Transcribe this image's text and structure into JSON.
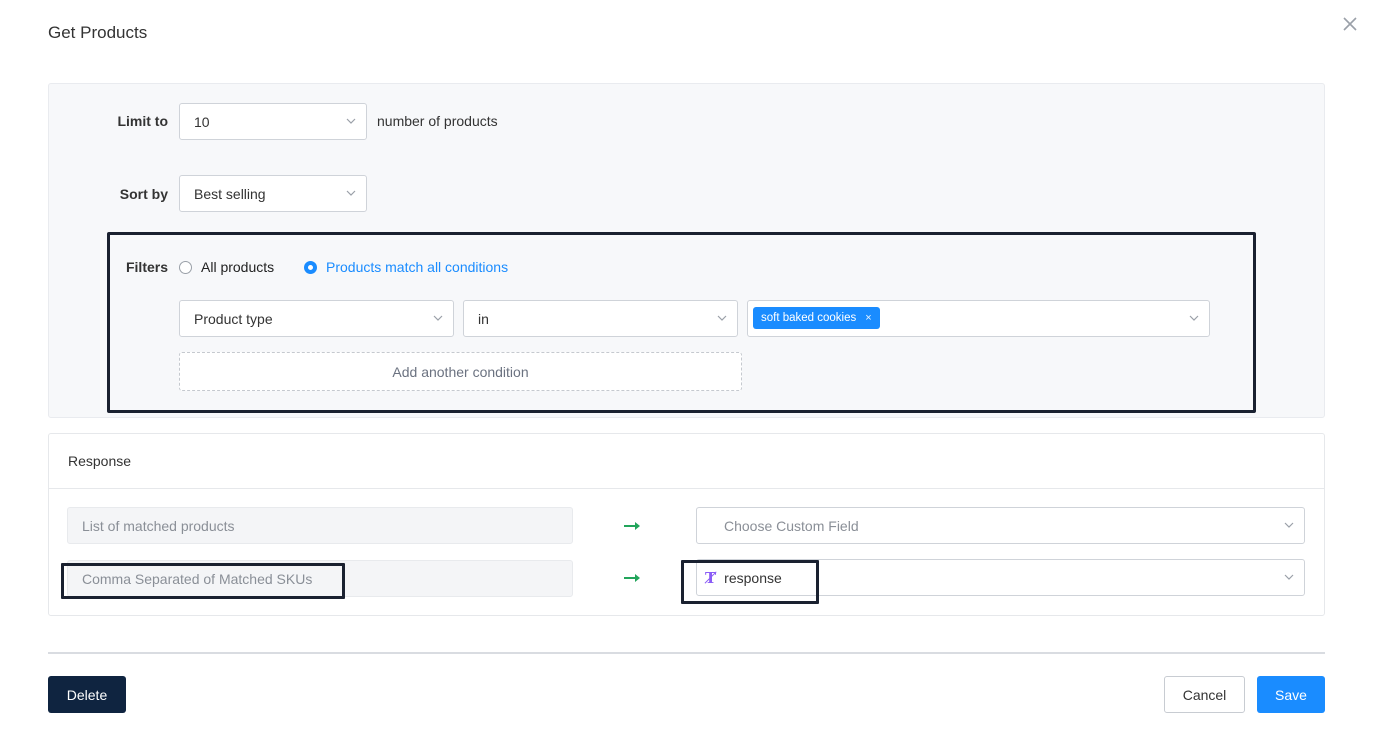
{
  "dialog": {
    "title": "Get Products"
  },
  "limit": {
    "label": "Limit to",
    "value": "10",
    "suffix": "number of products"
  },
  "sort": {
    "label": "Sort by",
    "value": "Best selling"
  },
  "filters": {
    "label": "Filters",
    "options": [
      {
        "label": "All products",
        "selected": false
      },
      {
        "label": "Products match all conditions",
        "selected": true
      }
    ],
    "condition": {
      "field": "Product type",
      "operator": "in",
      "values": [
        "soft baked cookies"
      ]
    },
    "add_condition_label": "Add another condition"
  },
  "response": {
    "header": "Response",
    "mappings": [
      {
        "source": "List of matched products",
        "target": "Choose Custom Field",
        "target_is_placeholder": true
      },
      {
        "source": "Comma Separated of Matched SKUs",
        "target": "response",
        "target_is_placeholder": false
      }
    ]
  },
  "buttons": {
    "delete": "Delete",
    "cancel": "Cancel",
    "save": "Save"
  },
  "colors": {
    "accent": "#1a8cff",
    "delete_bg": "#0f2440",
    "arrow": "#22a55b",
    "custom_field_icon": "#8b5cf6"
  },
  "icons": {
    "close": "close-icon",
    "chevron": "chevron-down-icon",
    "arrow": "arrow-right-icon",
    "custom_field": "text-field-icon"
  }
}
